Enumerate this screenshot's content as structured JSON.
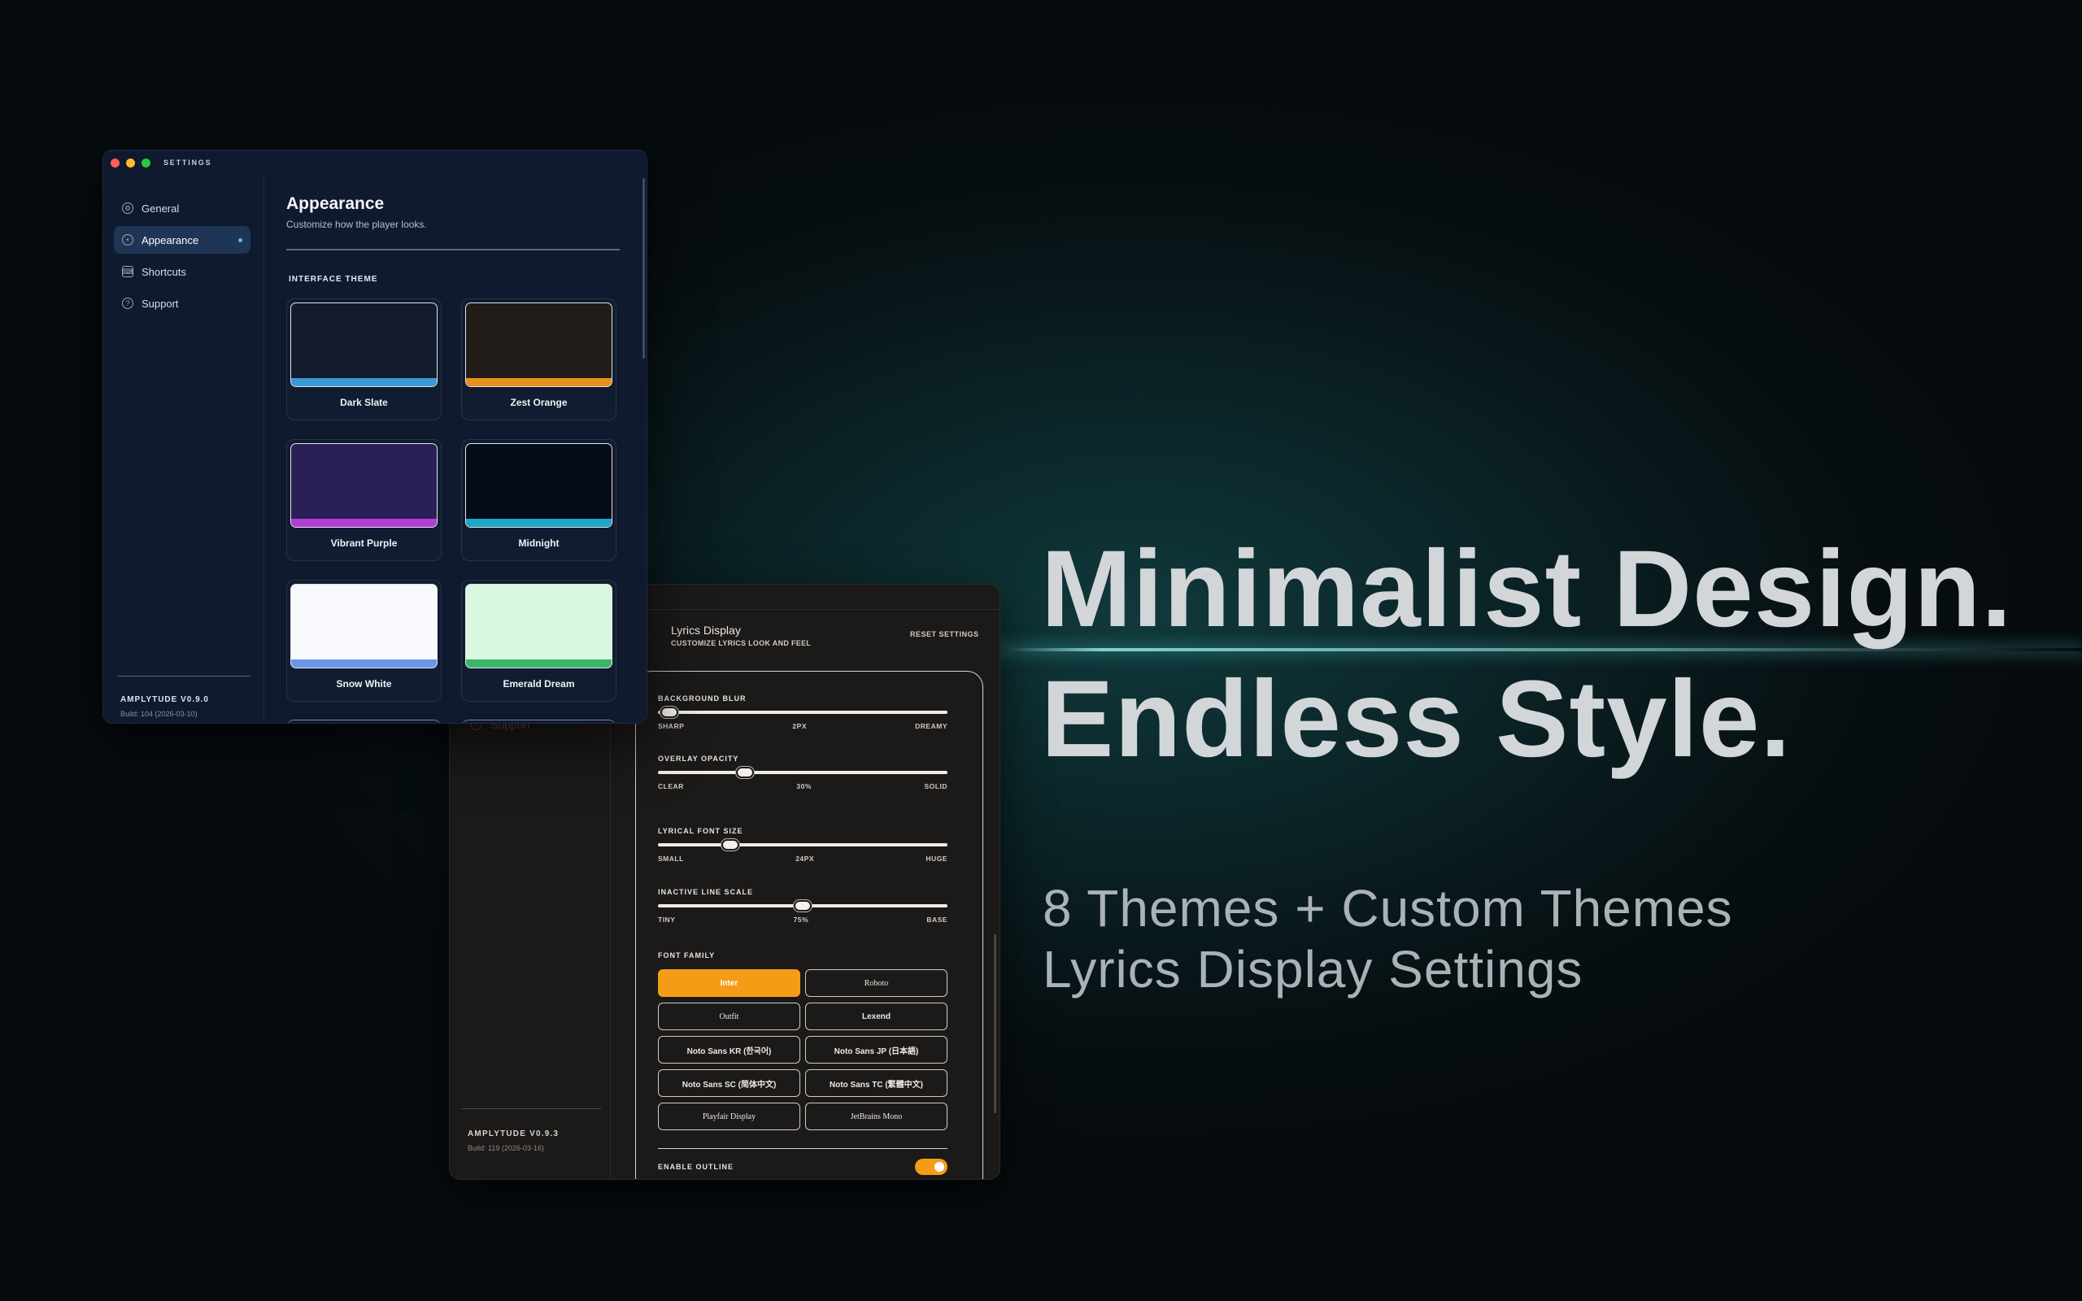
{
  "hero": {
    "line1": "Minimalist Design.",
    "line2": "Endless Style.",
    "tagline1": "8 Themes + Custom Themes",
    "tagline2": "Lyrics Display Settings"
  },
  "settings_window": {
    "title": "SETTINGS",
    "nav": [
      {
        "label": "General",
        "icon": "gear-icon"
      },
      {
        "label": "Appearance",
        "icon": "palette-icon",
        "active": true
      },
      {
        "label": "Shortcuts",
        "icon": "keyboard-icon"
      },
      {
        "label": "Support",
        "icon": "help-circle-icon"
      }
    ],
    "version": "AMPLYTUDE V0.9.0",
    "build": "Build: 104 (2026-03-10)",
    "page_title": "Appearance",
    "page_subtitle": "Customize how the player looks.",
    "section_label": "INTERFACE THEME",
    "themes": [
      {
        "name": "Dark Slate",
        "bg": "#121a2b",
        "accent": "#3a9bd4"
      },
      {
        "name": "Zest Orange",
        "bg": "#211c17",
        "accent": "#e8901c"
      },
      {
        "name": "Vibrant Purple",
        "bg": "#2a2055",
        "accent": "#b13fd6"
      },
      {
        "name": "Midnight",
        "bg": "#060c1a",
        "accent": "#1ea6c8"
      },
      {
        "name": "Snow White",
        "bg": "#f7f9fd",
        "accent": "#6b96e8"
      },
      {
        "name": "Emerald Dream",
        "bg": "#d9f8e0",
        "accent": "#3bb46a"
      }
    ]
  },
  "lyrics_window": {
    "sidebar_support": "Support",
    "version": "AMPLYTUDE V0.9.3",
    "build": "Build: 119 (2026-03-16)",
    "title": "Lyrics Display",
    "subtitle": "CUSTOMIZE LYRICS LOOK AND FEEL",
    "reset_label": "RESET SETTINGS",
    "sliders": [
      {
        "label": "BACKGROUND BLUR",
        "min_label": "SHARP",
        "value_label": "2PX",
        "max_label": "DREAMY",
        "value": 0.04
      },
      {
        "label": "OVERLAY OPACITY",
        "min_label": "CLEAR",
        "value_label": "30%",
        "max_label": "SOLID",
        "value": 0.3
      },
      {
        "label": "LYRICAL FONT SIZE",
        "min_label": "SMALL",
        "value_label": "24PX",
        "max_label": "HUGE",
        "value": 0.25
      },
      {
        "label": "INACTIVE LINE SCALE",
        "min_label": "TINY",
        "value_label": "75%",
        "max_label": "BASE",
        "value": 0.5
      }
    ],
    "font_family_label": "FONT FAMILY",
    "fonts": [
      {
        "label": "Inter",
        "active": true,
        "serif": false
      },
      {
        "label": "Roboto",
        "active": false,
        "serif": true
      },
      {
        "label": "Outfit",
        "active": false,
        "serif": true
      },
      {
        "label": "Lexend",
        "active": false,
        "serif": false
      },
      {
        "label": "Noto Sans KR (한국어)",
        "active": false,
        "serif": false
      },
      {
        "label": "Noto Sans JP (日本語)",
        "active": false,
        "serif": false
      },
      {
        "label": "Noto Sans SC (简体中文)",
        "active": false,
        "serif": false
      },
      {
        "label": "Noto Sans TC (繁體中文)",
        "active": false,
        "serif": false
      },
      {
        "label": "Playfair Display",
        "active": false,
        "serif": true
      },
      {
        "label": "JetBrains Mono",
        "active": false,
        "serif": true
      }
    ],
    "outline_label": "ENABLE OUTLINE",
    "outline_enabled": true
  }
}
